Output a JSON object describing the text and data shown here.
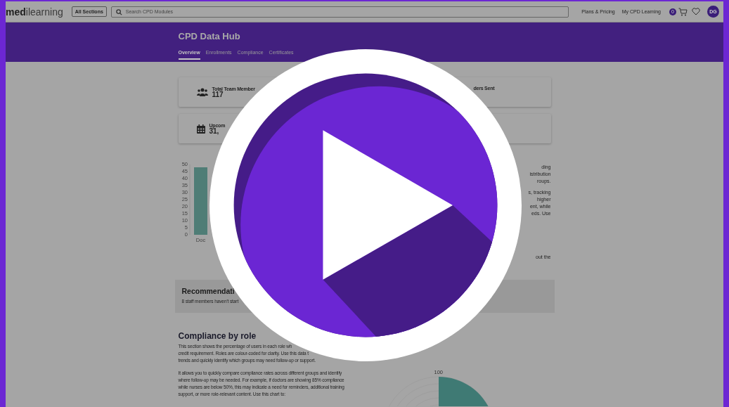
{
  "nav": {
    "logo_bold": "med",
    "logo_rest": "ilearning",
    "sections_button": "All Sections",
    "search": {
      "placeholder": "Search CPD Modules"
    },
    "links": [
      "Plans & Pricing",
      "My CPD Learning"
    ],
    "cart_count": "0",
    "avatar": "DG"
  },
  "header": {
    "title": "CPD Data Hub",
    "tabs": [
      {
        "label": "Overview",
        "selected": true
      },
      {
        "label": "Enrollments",
        "selected": false
      },
      {
        "label": "Compliance",
        "selected": false
      },
      {
        "label": "Certificates",
        "selected": false
      }
    ]
  },
  "stats": [
    {
      "label": "Total Team Member",
      "value": "117",
      "right_label": "ders Sent"
    },
    {
      "label": "Upcom",
      "value": "31,"
    }
  ],
  "bar_chart": {
    "chart_data": {
      "type": "bar",
      "categories": [
        "Doc"
      ],
      "values": [
        48
      ],
      "ylim": [
        0,
        50
      ],
      "yticks": [
        0,
        5,
        10,
        15,
        20,
        25,
        30,
        35,
        40,
        45,
        50
      ]
    }
  },
  "side_text": {
    "group_1": [
      "ding",
      "istribution",
      "roups."
    ],
    "group_2": [
      "s, tracking",
      "higher",
      "ent, while",
      "eds. Use"
    ],
    "group_3": [
      "out the"
    ]
  },
  "recommendations": {
    "title": "Recommendati",
    "text": "8 staff members haven't start"
  },
  "compliance": {
    "title": "Compliance by role",
    "paragraphs": [
      [
        "This section shows the percentage of users in each role wh",
        "credit requirement. Roles are colour-coded for clarity. Use this data t",
        "trends and quickly identify which groups may need follow-up or support."
      ],
      [
        "It allows you to quickly compare compliance rates across different groups and identify",
        "where follow-up may be needed. For example, if doctors are showing 85% compliance",
        "while nurses are below 50%, this may indicate a need for reminders, additional training",
        "support, or more role-relevant content. Use this chart to:"
      ]
    ],
    "polar_tick": "100"
  }
}
